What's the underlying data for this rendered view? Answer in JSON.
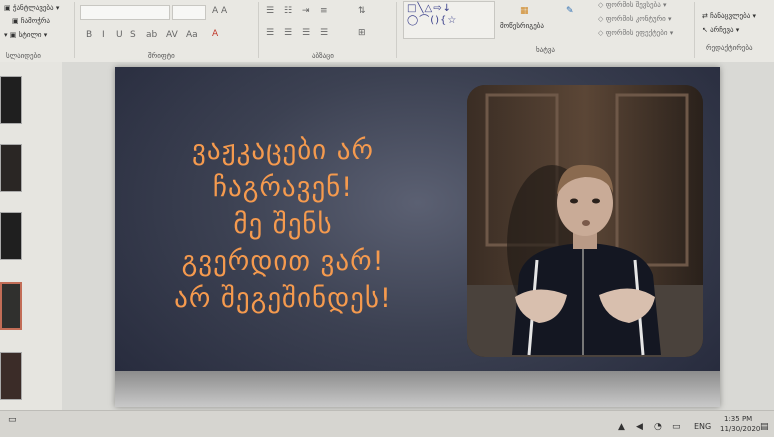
{
  "ribbon": {
    "font_box": {
      "size_arrows": "A A"
    },
    "format_buttons": [
      "B",
      "I",
      "U",
      "S",
      "ab",
      "AV",
      "Aa"
    ],
    "clipboard_items": [
      "ჭანტლავება",
      "ჩამოჭრა",
      "სტილი"
    ],
    "group_labels": {
      "slides": "სლაიდები",
      "font": "შრიფტი",
      "paragraph": "აბზაცი",
      "drawing": "ხატვა",
      "editing": "რედაქტირება"
    },
    "arrange_label": "მოწესრიგება",
    "shape_styles": [
      "ფორმის შევსება",
      "ფორმის კონტური",
      "ფორმის ეფექტები"
    ],
    "editing_items": [
      "ჩანაცვლება",
      "არჩევა"
    ],
    "shape_gallery_glyphs": [
      "□",
      "╲",
      "△",
      "⇨",
      "↓",
      "◯",
      "⌒",
      "(",
      ")",
      "{",
      "☆"
    ]
  },
  "slide": {
    "text_lines": [
      "ვაჟკაცები არ",
      "ჩაგრავენ!",
      "მე შენს",
      "გვერდით ვარ!",
      "არ შეგეშინდეს!"
    ],
    "text_color": "#f59a4e"
  },
  "taskbar": {
    "language": "ENG",
    "time": "1:35 PM",
    "date": "11/30/2020"
  }
}
